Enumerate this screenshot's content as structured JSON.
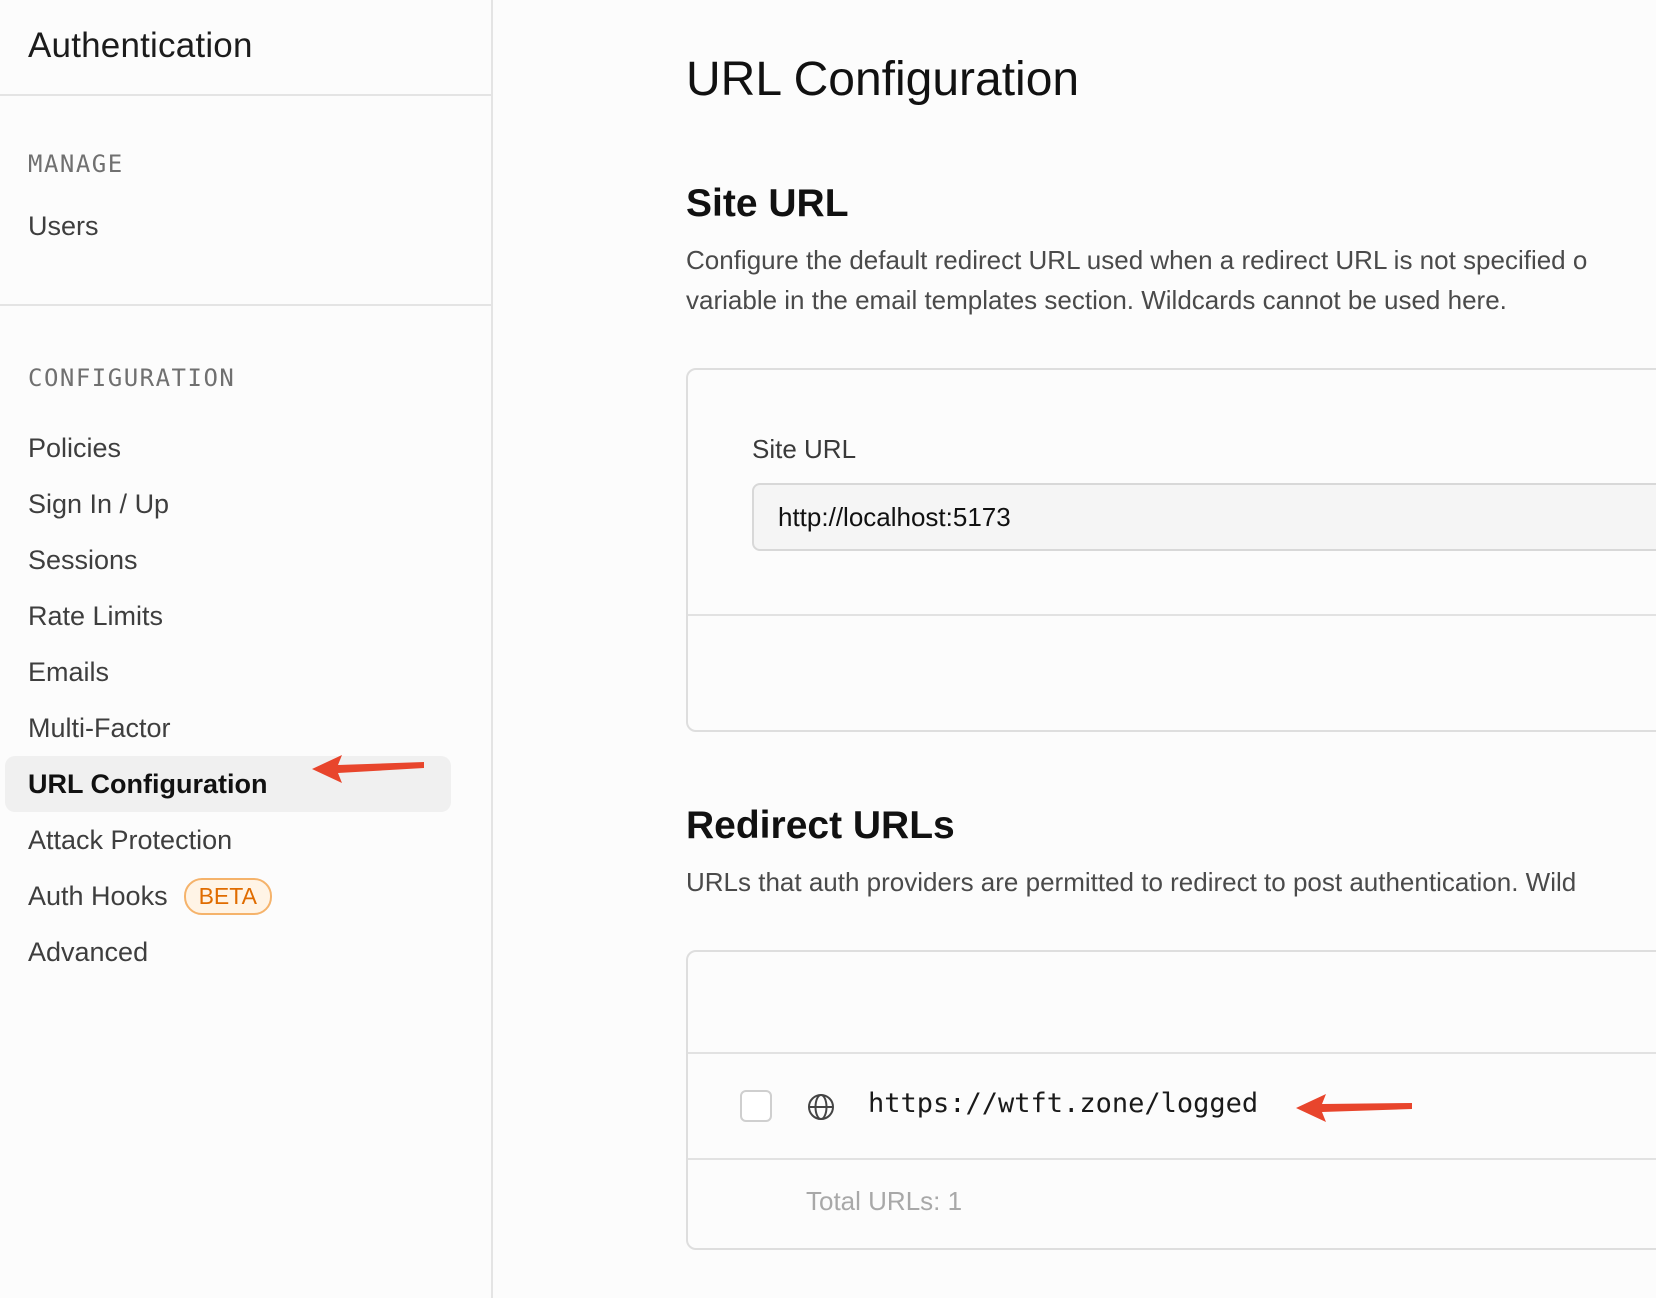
{
  "sidebar": {
    "title": "Authentication",
    "manage": {
      "label": "MANAGE",
      "items": [
        {
          "label": "Users"
        }
      ]
    },
    "configuration": {
      "label": "CONFIGURATION",
      "items": [
        {
          "label": "Policies"
        },
        {
          "label": "Sign In / Up"
        },
        {
          "label": "Sessions"
        },
        {
          "label": "Rate Limits"
        },
        {
          "label": "Emails"
        },
        {
          "label": "Multi-Factor"
        },
        {
          "label": "URL Configuration"
        },
        {
          "label": "Attack Protection"
        },
        {
          "label": "Auth Hooks",
          "badge": "BETA"
        },
        {
          "label": "Advanced"
        }
      ]
    }
  },
  "main": {
    "title": "URL Configuration",
    "site_url": {
      "heading": "Site URL",
      "description_line1": "Configure the default redirect URL used when a redirect URL is not specified o",
      "description_line2": "variable in the email templates section. Wildcards cannot be used here.",
      "field_label": "Site URL",
      "field_value": "http://localhost:5173"
    },
    "redirect_urls": {
      "heading": "Redirect URLs",
      "description": "URLs that auth providers are permitted to redirect to post authentication. Wild",
      "items": [
        {
          "url": "https://wtft.zone/logged"
        }
      ],
      "total": "Total URLs: 1"
    }
  },
  "colors": {
    "annotation_arrow": "#e8452c",
    "badge_text": "#e06c00",
    "badge_border": "#f5b36b",
    "active_bg": "#f0f0f0"
  }
}
